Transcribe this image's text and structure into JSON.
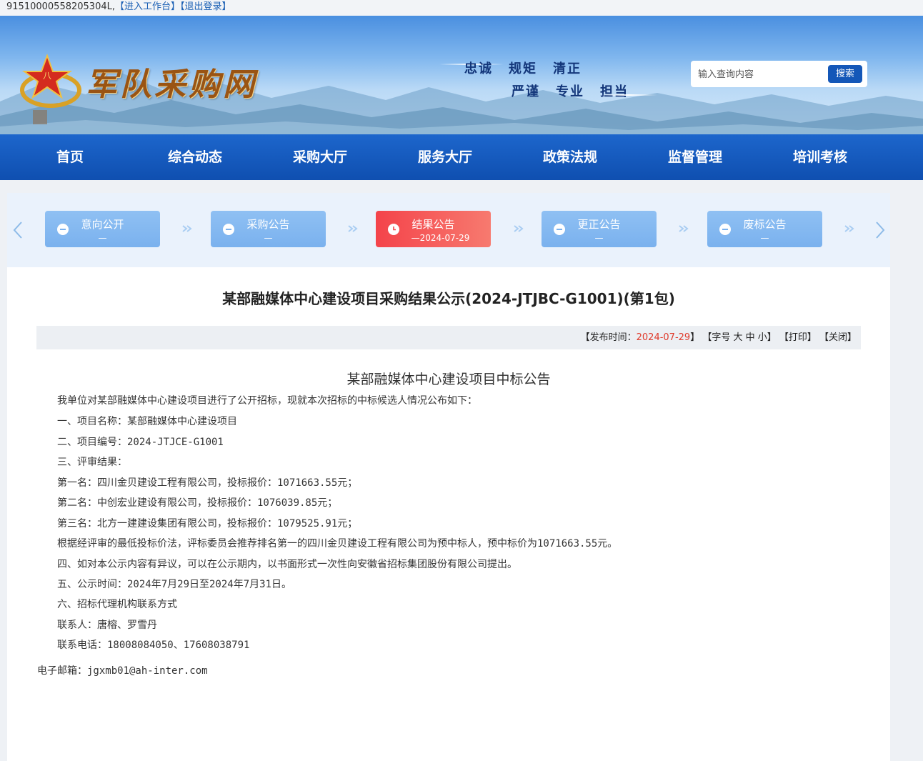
{
  "topbar": {
    "account": "91510000558205304L,",
    "enter_workbench": "【进入工作台】",
    "logout": "【退出登录】"
  },
  "header": {
    "site_name": "军队采购网",
    "slogan_row1": [
      "忠诚",
      "规矩",
      "清正"
    ],
    "slogan_row2": [
      "严谨",
      "专业",
      "担当"
    ],
    "search_placeholder": "输入查询内容",
    "search_button": "搜索"
  },
  "nav": {
    "items": [
      "首页",
      "综合动态",
      "采购大厅",
      "服务大厅",
      "政策法规",
      "监督管理",
      "培训考核"
    ]
  },
  "steps": [
    {
      "label": "意向公开",
      "date": "—",
      "active": false
    },
    {
      "label": "采购公告",
      "date": "—",
      "active": false
    },
    {
      "label": "结果公告",
      "date": "—2024-07-29",
      "active": true
    },
    {
      "label": "更正公告",
      "date": "—",
      "active": false
    },
    {
      "label": "废标公告",
      "date": "—",
      "active": false
    }
  ],
  "article": {
    "title": "某部融媒体中心建设项目采购结果公示(2024-JTJBC-G1001)(第1包)",
    "meta_prefix": "【发布时间：",
    "publish_date": "2024-07-29",
    "meta_suffix": "】 【字号 大 中 小】 【打印】 【关闭】",
    "subtitle": "某部融媒体中心建设项目中标公告",
    "lines": [
      "我单位对某部融媒体中心建设项目进行了公开招标，现就本次招标的中标候选人情况公布如下：",
      "一、项目名称：某部融媒体中心建设项目",
      "二、项目编号：2024-JTJCE-G1001",
      "三、评审结果：",
      "第一名：四川金贝建设工程有限公司，投标报价：1071663.55元；",
      "第二名：中创宏业建设有限公司，投标报价：1076039.85元；",
      "第三名：北方一建建设集团有限公司，投标报价：1079525.91元；",
      "根据经评审的最低投标价法，评标委员会推荐排名第一的四川金贝建设工程有限公司为预中标人，预中标价为1071663.55元。",
      " 四、如对本公示内容有异议，可以在公示期内，以书面形式一次性向安徽省招标集团股份有限公司提出。",
      "五、公示时间：2024年7月29日至2024年7月31日。",
      "六、招标代理机构联系方式",
      "联系人：唐榕、罗雪丹",
      "联系电话：18008084050、17608038791"
    ],
    "email": "电子邮箱：jgxmb01@ah-inter.com"
  },
  "colors": {
    "nav_blue": "#1457b8",
    "active_step": "#f4434a",
    "inactive_step": "#7ab1ee",
    "date_red": "#e0392a"
  }
}
